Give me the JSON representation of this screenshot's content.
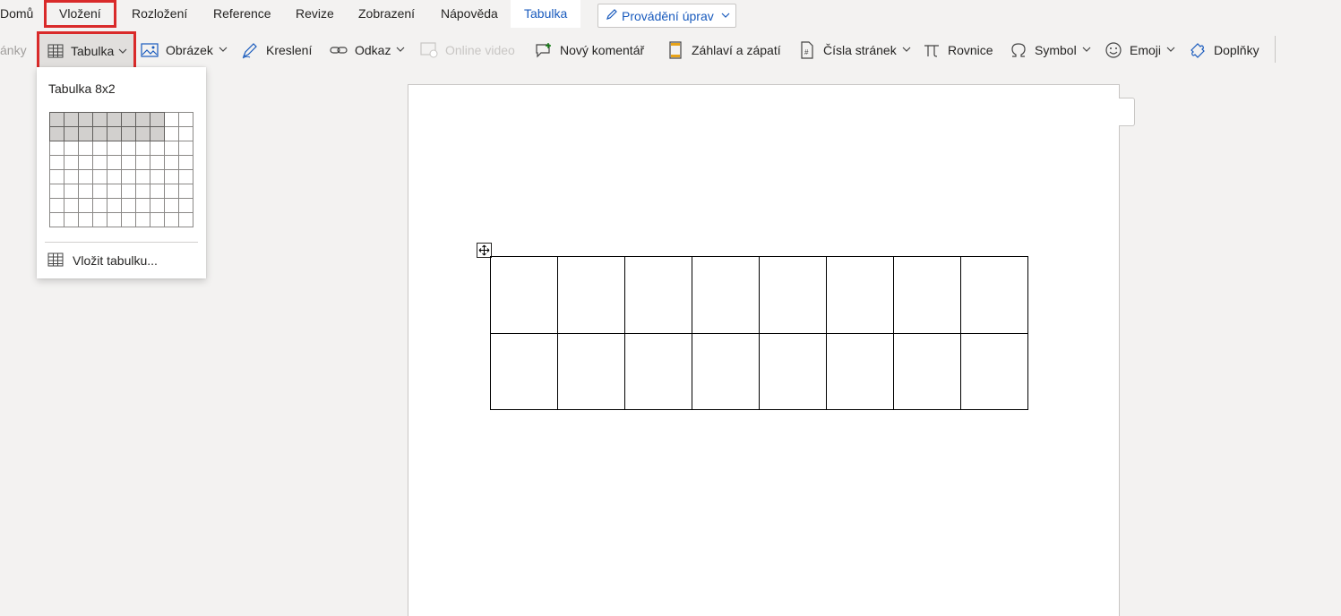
{
  "tabs": {
    "home": "Domů",
    "insert": "Vložení",
    "layout": "Rozložení",
    "references": "Reference",
    "review": "Revize",
    "view": "Zobrazení",
    "help": "Nápověda",
    "table": "Tabulka"
  },
  "edit_mode": {
    "label": "Provádění úprav"
  },
  "ribbon": {
    "pages_partial": "ánky",
    "table": "Tabulka",
    "picture": "Obrázek",
    "drawing": "Kreslení",
    "link": "Odkaz",
    "online_video": "Online video",
    "new_comment": "Nový komentář",
    "header_footer": "Záhlaví a zápatí",
    "page_numbers": "Čísla stránek",
    "equation": "Rovnice",
    "symbol": "Symbol",
    "emoji": "Emoji",
    "addins": "Doplňky"
  },
  "table_dropdown": {
    "title": "Tabulka 8x2",
    "selected_cols": 8,
    "selected_rows": 2,
    "grid_cols": 10,
    "grid_rows": 8,
    "insert_label": "Vložit tabulku..."
  },
  "document": {
    "table_rows": 2,
    "table_cols": 8
  },
  "colors": {
    "accent": "#185abd",
    "highlight": "#d92a2a"
  }
}
